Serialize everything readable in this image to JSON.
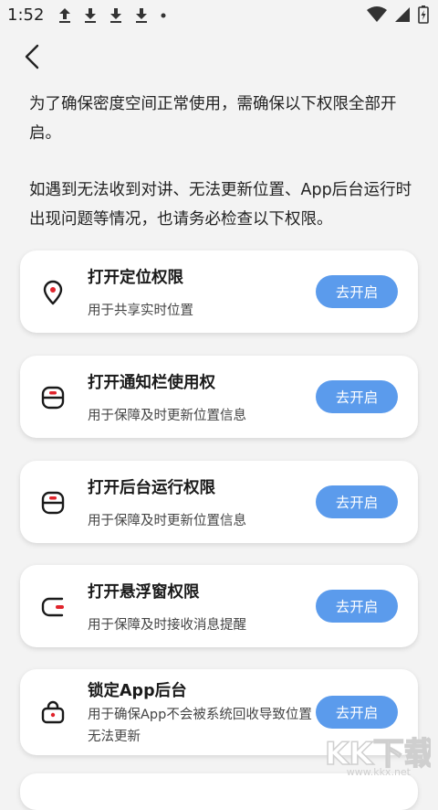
{
  "status_bar": {
    "time": "1:52",
    "icons": [
      "upload-icon",
      "download-icon",
      "download-icon",
      "download-icon",
      "dot-icon"
    ],
    "right_icons": [
      "wifi-icon",
      "signal-icon",
      "battery-icon"
    ]
  },
  "header": {
    "back_icon": "chevron-left-icon"
  },
  "intro": {
    "paragraph_1": "为了确保密度空间正常使用，需确保以下权限全部开启。",
    "paragraph_2": "如遇到无法收到对讲、无法更新位置、App后台运行时出现问题等情况，也请务必检查以下权限。"
  },
  "permissions": [
    {
      "icon": "location-pin-icon",
      "title": "打开定位权限",
      "description": "用于共享实时位置",
      "button": "去开启"
    },
    {
      "icon": "notification-bar-icon",
      "title": "打开通知栏使用权",
      "description": "用于保障及时更新位置信息",
      "button": "去开启"
    },
    {
      "icon": "background-run-icon",
      "title": "打开后台运行权限",
      "description": "用于保障及时更新位置信息",
      "button": "去开启"
    },
    {
      "icon": "floating-window-icon",
      "title": "打开悬浮窗权限",
      "description": "用于保障及时接收消息提醒",
      "button": "去开启"
    },
    {
      "icon": "lock-icon",
      "title": "锁定App后台",
      "description": "用于确保App不会被系统回收导致位置无法更新",
      "button": "去开启"
    }
  ],
  "watermark": {
    "logo_text": "KK下载",
    "url": "www.kkx.net"
  },
  "colors": {
    "accent": "#5b9bec",
    "icon_red": "#e0242c",
    "background": "#f3f3f3"
  }
}
